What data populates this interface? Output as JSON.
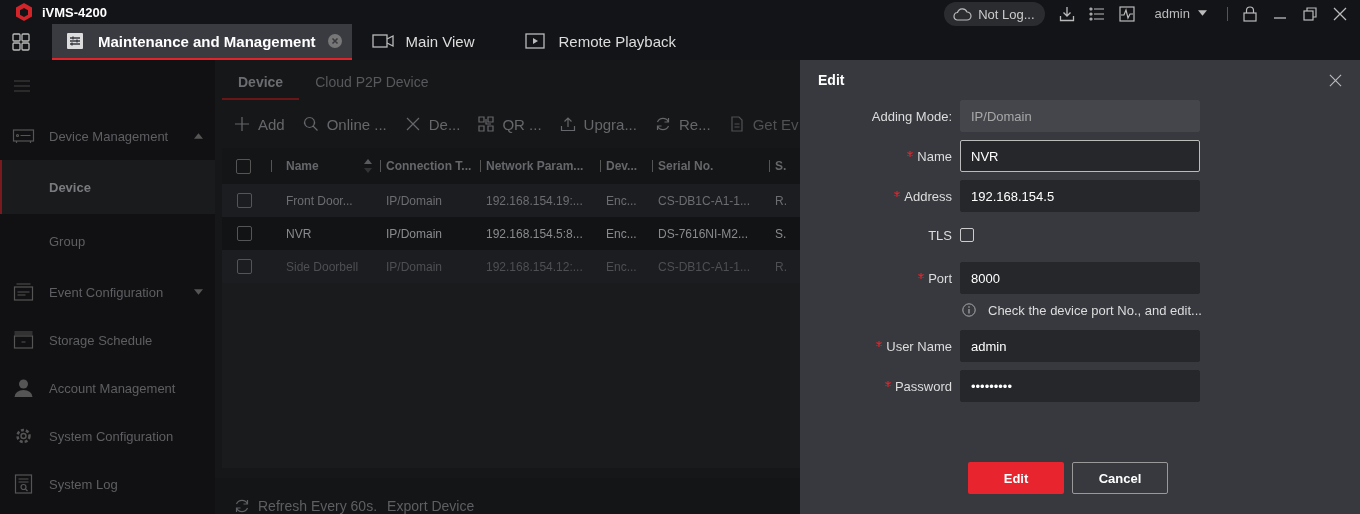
{
  "app": {
    "title": "iVMS-4200"
  },
  "top_bar": {
    "cloud_status": "Not Log...",
    "user": "admin"
  },
  "tabs": [
    {
      "label": "Maintenance and Management",
      "selected": true,
      "closable": true
    },
    {
      "label": "Main View",
      "selected": false,
      "closable": false
    },
    {
      "label": "Remote Playback",
      "selected": false,
      "closable": false
    }
  ],
  "sidebar": {
    "items": [
      {
        "label": "Device Management",
        "kind": "group",
        "expanded": true,
        "children": [
          {
            "label": "Device",
            "selected": true
          },
          {
            "label": "Group",
            "selected": false
          }
        ]
      },
      {
        "label": "Event Configuration",
        "kind": "group",
        "expanded": false
      },
      {
        "label": "Storage Schedule",
        "kind": "link"
      },
      {
        "label": "Account Management",
        "kind": "link"
      },
      {
        "label": "System Configuration",
        "kind": "link"
      },
      {
        "label": "System Log",
        "kind": "link"
      }
    ]
  },
  "sub_tabs": [
    {
      "label": "Device",
      "selected": true
    },
    {
      "label": "Cloud P2P Device",
      "selected": false
    }
  ],
  "toolbar": [
    {
      "label": "Add",
      "disabled": false
    },
    {
      "label": "Online ...",
      "disabled": false
    },
    {
      "label": "De...",
      "disabled": false
    },
    {
      "label": "QR ...",
      "disabled": false
    },
    {
      "label": "Upgra...",
      "disabled": false
    },
    {
      "label": "Re...",
      "disabled": false
    },
    {
      "label": "Get Ev",
      "disabled": true
    }
  ],
  "table": {
    "select_all": {
      "checked": false
    },
    "columns": [
      "Name",
      "Connection T...",
      "Network Param...",
      "Dev...",
      "Serial No.",
      "S."
    ],
    "rows": [
      {
        "cells": [
          "Front Door...",
          "IP/Domain",
          "192.168.154.19:...",
          "Enc...",
          "CS-DB1C-A1-1...",
          "R."
        ],
        "checked": false,
        "selected": false,
        "disabled": false
      },
      {
        "cells": [
          "NVR",
          "IP/Domain",
          "192.168.154.5:8...",
          "Enc...",
          "DS-7616NI-M2...",
          "S."
        ],
        "checked": false,
        "selected": true,
        "disabled": false
      },
      {
        "cells": [
          "Side Doorbell",
          "IP/Domain",
          "192.168.154.12:...",
          "Enc...",
          "CS-DB1C-A1-1...",
          "R."
        ],
        "checked": false,
        "selected": false,
        "disabled": true
      }
    ]
  },
  "footer": [
    "Refresh Every 60s.",
    "Export Device"
  ],
  "dialog": {
    "title": "Edit",
    "fields": [
      {
        "label": "Adding Mode:",
        "kind": "readonly",
        "value": "IP/Domain",
        "required": false,
        "focused": false
      },
      {
        "label": "Name",
        "kind": "text",
        "value": "NVR",
        "required": true,
        "focused": true
      },
      {
        "label": "Address",
        "kind": "text",
        "value": "192.168.154.5",
        "required": true,
        "focused": false
      },
      {
        "label": "TLS",
        "kind": "checkbox",
        "checked": false,
        "required": false
      },
      {
        "label": "Port",
        "kind": "text",
        "value": "8000",
        "required": true,
        "focused": false
      },
      {
        "kind": "hint",
        "text": "Check the device port No., and edit..."
      },
      {
        "label": "User Name",
        "kind": "text",
        "value": "admin",
        "required": true,
        "focused": false
      },
      {
        "label": "Password",
        "kind": "text",
        "value": "•••••••••",
        "required": true,
        "focused": false
      }
    ],
    "buttons": [
      {
        "label": "Edit",
        "kind": "primary"
      },
      {
        "label": "Cancel",
        "kind": "secondary"
      }
    ]
  }
}
